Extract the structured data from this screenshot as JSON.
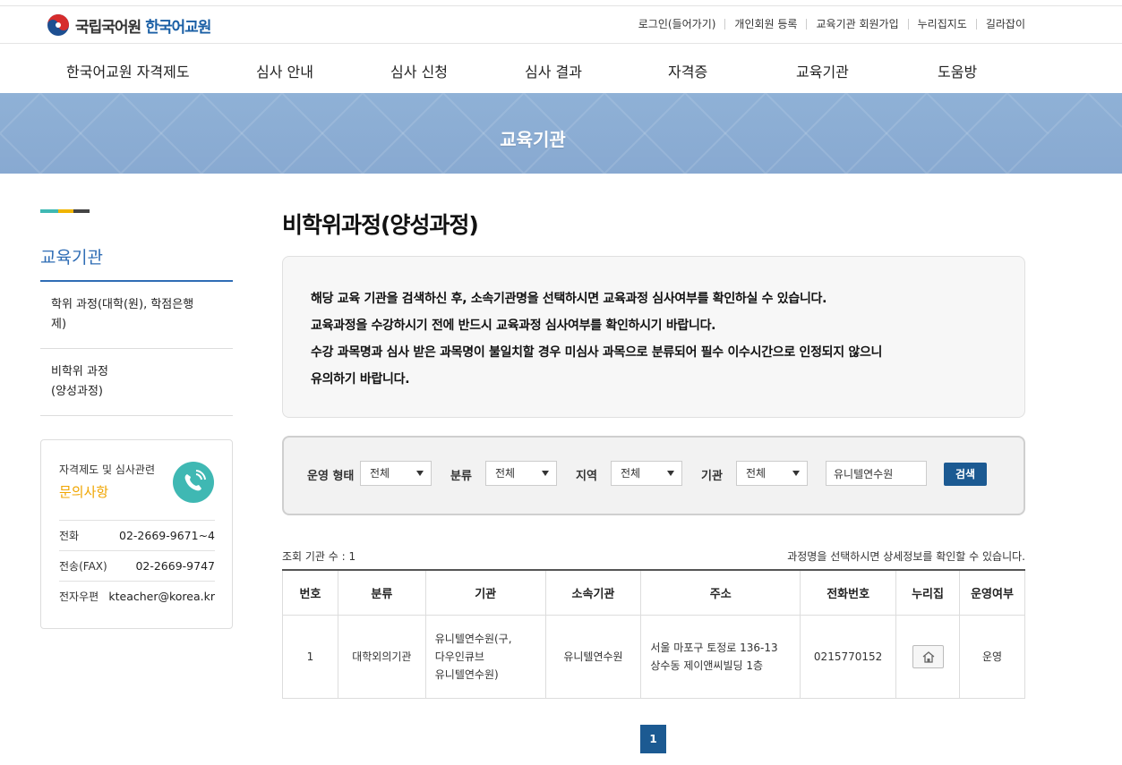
{
  "header": {
    "logo_org": "국립국어원",
    "logo_service": "한국어교원",
    "util_links": [
      "로그인(들어가기)",
      "개인회원 등록",
      "교육기관 회원가입",
      "누리집지도",
      "길라잡이"
    ]
  },
  "gnb": [
    "한국어교원 자격제도",
    "심사 안내",
    "심사 신청",
    "심사 결과",
    "자격증",
    "교육기관",
    "도움방"
  ],
  "banner": {
    "title": "교육기관"
  },
  "sidebar": {
    "title": "교육기관",
    "items": [
      {
        "line1": "학위 과정(대학(원), 학점은행",
        "line2": "제)"
      },
      {
        "line1": "비학위 과정",
        "line2": "(양성과정)"
      }
    ],
    "contact": {
      "subtitle": "자격제도 및 심사관련",
      "title": "문의사항",
      "rows": [
        {
          "label": "전화",
          "value": "02-2669-9671~4"
        },
        {
          "label": "전송(FAX)",
          "value": "02-2669-9747"
        },
        {
          "label": "전자우편",
          "value": "kteacher@korea.kr"
        }
      ]
    }
  },
  "main": {
    "title": "비학위과정(양성과정)",
    "notice": [
      "해당 교육 기관을 검색하신 후, 소속기관명을 선택하시면 교육과정 심사여부를 확인하실 수 있습니다.",
      "교육과정을 수강하시기 전에 반드시 교육과정 심사여부를 확인하시기 바랍니다.",
      "수강 과목명과 심사 받은 과목명이 불일치할 경우 미심사 과목으로 분류되어 필수 이수시간으로 인정되지 않으니",
      "유의하기 바랍니다."
    ],
    "search": {
      "type_label": "운영 형태",
      "type_value": "전체",
      "category_label": "분류",
      "category_value": "전체",
      "region_label": "지역",
      "region_value": "전체",
      "org_label": "기관",
      "org_value": "전체",
      "keyword_value": "유니텔연수원",
      "button": "검색"
    },
    "count_text": "조회 기관 수 : 1",
    "hint_text": "과정명을 선택하시면 상세정보를 확인할 수 있습니다.",
    "table": {
      "headers": [
        "번호",
        "분류",
        "기관",
        "소속기관",
        "주소",
        "전화번호",
        "누리집",
        "운영여부"
      ],
      "rows": [
        {
          "no": "1",
          "category": "대학외의기관",
          "org_lines": [
            "유니텔연수원(구,",
            "다우인큐브",
            "유니텔연수원)"
          ],
          "affiliate": "유니텔연수원",
          "address_lines": [
            "서울 마포구 토정로 136-13",
            "상수동 제이앤씨빌딩 1층"
          ],
          "phone": "0215770152",
          "status": "운영"
        }
      ]
    },
    "pager": {
      "current": "1"
    }
  },
  "colors": {
    "brand_blue": "#2f6db5",
    "button_blue": "#1c5a92",
    "banner_blue": "#8fb1d6",
    "accent_orange": "#f0a500",
    "accent_teal": "#3fb8b3"
  }
}
